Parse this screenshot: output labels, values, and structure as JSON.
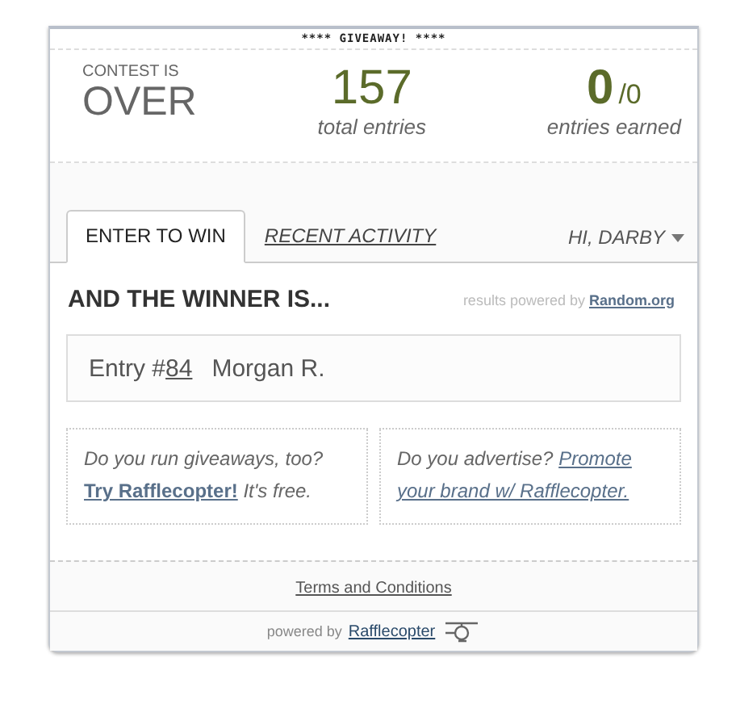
{
  "banner": "**** GIVEAWAY! ****",
  "stats": {
    "status_label": "CONTEST IS",
    "status": "OVER",
    "total": "157",
    "total_label": "total entries",
    "earned": "0",
    "earned_of": "/0",
    "earned_label": "entries earned"
  },
  "tabs": [
    {
      "label": "ENTER TO WIN",
      "selected": true
    },
    {
      "label": "RECENT ACTIVITY",
      "selected": false
    }
  ],
  "user_menu": "HI, DARBY",
  "winner": {
    "heading": "AND THE WINNER IS...",
    "powered_text": "results powered by",
    "powered_link": "Random.org",
    "entry_prefix": "Entry #",
    "entry_number": "84",
    "name": "Morgan R."
  },
  "promos": [
    {
      "before": "Do you run giveaways, too?",
      "link_lines": [
        "Try Rafflecopter!"
      ],
      "after": "It's free."
    },
    {
      "before": "Do you advertise?",
      "link_lines": [
        "Promote",
        "your brand w/ Rafflecopter."
      ]
    }
  ],
  "terms": "Terms and Conditions",
  "footer": {
    "text": "powered by",
    "link": "Rafflecopter"
  }
}
